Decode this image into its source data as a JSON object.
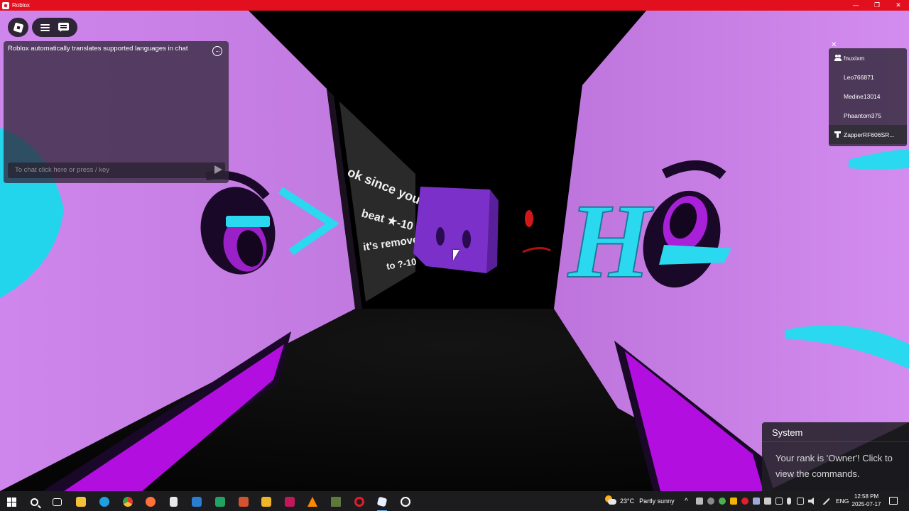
{
  "window": {
    "title": "Roblox",
    "minimize": "—",
    "restore": "❐",
    "close": "✕"
  },
  "chat": {
    "system_message": "Roblox automatically translates supported languages in chat",
    "more_icon": "···",
    "input_placeholder": "To chat click here or press / key"
  },
  "player_list": {
    "close_icon": "✕",
    "players": [
      {
        "name": "fnuxixm",
        "icon": "friends-icon"
      },
      {
        "name": "Leo766871",
        "icon": ""
      },
      {
        "name": "Medine13014",
        "icon": ""
      },
      {
        "name": "Phaantom375",
        "icon": ""
      },
      {
        "name": "ZapperRF606SR...",
        "icon": "premium-icon"
      }
    ]
  },
  "notification": {
    "title": "System",
    "message": "Your rank is 'Owner'! Click to view the commands."
  },
  "scene": {
    "sign_lines": [
      "ok since you can't",
      "beat ★-10 since",
      "it's removed ★",
      "to ?-10"
    ],
    "letter_h": "H",
    "colors": {
      "wall": "#c97de8",
      "accent_purple": "#b20ee0",
      "cyan": "#2ad8f0",
      "cube": "#7a30c8"
    }
  },
  "taskbar": {
    "weather": "23°C",
    "weather_desc": "Partly sunny",
    "language": "ENG",
    "time": "12:58 PM",
    "date": "2025-07-17",
    "tray_chevron": "^"
  }
}
